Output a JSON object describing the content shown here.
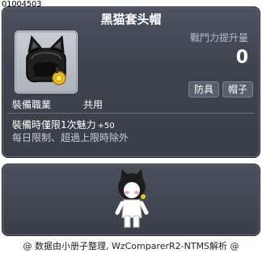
{
  "item_id": "01004503",
  "tooltip": {
    "title": "黑猫套头帽",
    "attack_label": "戰鬥力提升量",
    "attack_value": "0",
    "tags": [
      "防具",
      "帽子"
    ],
    "job_label": "裝備職業",
    "job_value": "共用",
    "desc_line1": "裝備時僅限1次魅力",
    "desc_line1_bonus": "+50",
    "desc_line2": "每日限制、超過上限時除外"
  },
  "footer": "@ 数据由小册子整理, WzComparerR2-NTMS解析 @",
  "icons": {
    "item": "black-cat-hood-icon",
    "preview": "character-preview"
  }
}
